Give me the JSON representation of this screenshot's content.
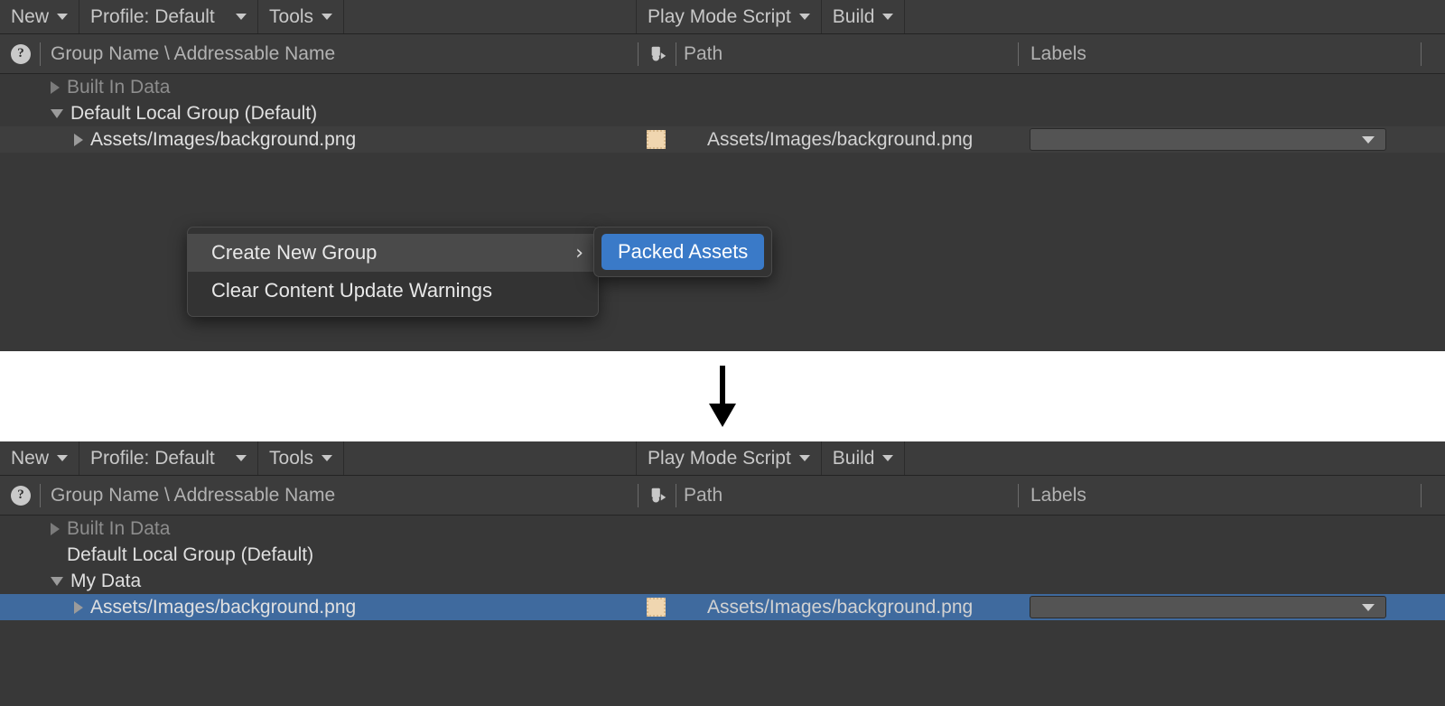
{
  "toolbar": {
    "new_label": "New",
    "profile_label": "Profile: Default",
    "tools_label": "Tools",
    "play_mode_label": "Play Mode Script",
    "build_label": "Build"
  },
  "columns": {
    "group_name": "Group Name \\ Addressable Name",
    "path": "Path",
    "labels": "Labels",
    "help_glyph": "?"
  },
  "panel_top": {
    "rows": [
      {
        "name": "Built In Data",
        "arrow": "collapsed",
        "dim": true,
        "indent": 1,
        "path": "",
        "thumb": false,
        "labels": false,
        "selected": false,
        "alt": false
      },
      {
        "name": "Default Local Group (Default)",
        "arrow": "expanded",
        "dim": false,
        "indent": 1,
        "path": "",
        "thumb": false,
        "labels": false,
        "selected": false,
        "alt": false
      },
      {
        "name": "Assets/Images/background.png",
        "arrow": "collapsed",
        "dim": false,
        "indent": 2,
        "path": "Assets/Images/background.png",
        "thumb": true,
        "labels": true,
        "selected": false,
        "alt": true
      }
    ]
  },
  "panel_bottom": {
    "rows": [
      {
        "name": "Built In Data",
        "arrow": "collapsed",
        "dim": true,
        "indent": 1,
        "path": "",
        "thumb": false,
        "labels": false,
        "selected": false,
        "alt": false
      },
      {
        "name": "Default Local Group (Default)",
        "arrow": "none",
        "dim": false,
        "indent": 1,
        "path": "",
        "thumb": false,
        "labels": false,
        "selected": false,
        "alt": false
      },
      {
        "name": "My Data",
        "arrow": "expanded",
        "dim": false,
        "indent": 1,
        "path": "",
        "thumb": false,
        "labels": false,
        "selected": false,
        "alt": false
      },
      {
        "name": "Assets/Images/background.png",
        "arrow": "collapsed",
        "dim": false,
        "indent": 2,
        "path": "Assets/Images/background.png",
        "thumb": true,
        "labels": true,
        "selected": true,
        "alt": false
      }
    ]
  },
  "context_menu": {
    "items": [
      {
        "label": "Create New Group",
        "submenu": true,
        "highlighted": true,
        "chevron": "›"
      },
      {
        "label": "Clear Content Update Warnings",
        "submenu": false,
        "highlighted": false,
        "chevron": ""
      }
    ]
  },
  "submenu": {
    "items": [
      {
        "label": "Packed Assets",
        "highlighted": true
      }
    ]
  },
  "colors": {
    "panel_bg": "#383838",
    "toolbar_bg": "#3c3c3c",
    "selection_blue": "#3f6a9e",
    "submenu_blue": "#3a7ac8",
    "thumb_tan": "#f0d6b0"
  },
  "flow": {
    "arrow_direction": "down"
  }
}
